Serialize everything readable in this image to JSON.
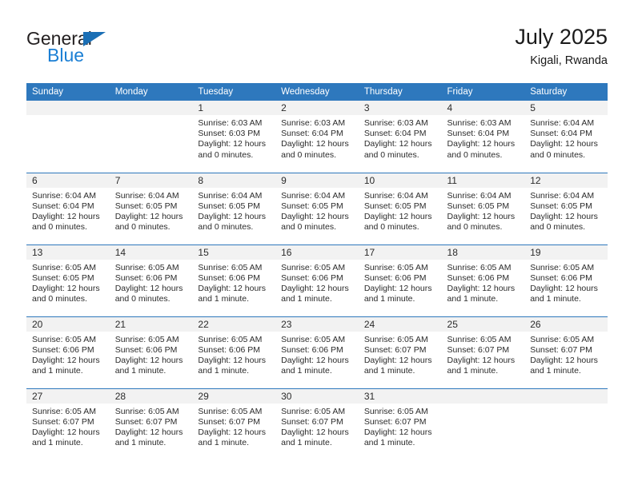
{
  "brand": {
    "name_part1": "General",
    "name_part2": "Blue",
    "triangle_color": "#1b6fb5",
    "blue_text_color": "#1b7fd4"
  },
  "header": {
    "title": "July 2025",
    "subtitle": "Kigali, Rwanda"
  },
  "theme": {
    "header_bar_color": "#2e78bd",
    "daynum_bg": "#f2f2f2",
    "text_color": "#2b2b2b"
  },
  "weekdays": [
    "Sunday",
    "Monday",
    "Tuesday",
    "Wednesday",
    "Thursday",
    "Friday",
    "Saturday"
  ],
  "weeks": [
    [
      {
        "day": "",
        "sunrise": "",
        "sunset": "",
        "daylight1": "",
        "daylight2": "",
        "empty": true
      },
      {
        "day": "",
        "sunrise": "",
        "sunset": "",
        "daylight1": "",
        "daylight2": "",
        "empty": true
      },
      {
        "day": "1",
        "sunrise": "Sunrise: 6:03 AM",
        "sunset": "Sunset: 6:03 PM",
        "daylight1": "Daylight: 12 hours",
        "daylight2": "and 0 minutes."
      },
      {
        "day": "2",
        "sunrise": "Sunrise: 6:03 AM",
        "sunset": "Sunset: 6:04 PM",
        "daylight1": "Daylight: 12 hours",
        "daylight2": "and 0 minutes."
      },
      {
        "day": "3",
        "sunrise": "Sunrise: 6:03 AM",
        "sunset": "Sunset: 6:04 PM",
        "daylight1": "Daylight: 12 hours",
        "daylight2": "and 0 minutes."
      },
      {
        "day": "4",
        "sunrise": "Sunrise: 6:03 AM",
        "sunset": "Sunset: 6:04 PM",
        "daylight1": "Daylight: 12 hours",
        "daylight2": "and 0 minutes."
      },
      {
        "day": "5",
        "sunrise": "Sunrise: 6:04 AM",
        "sunset": "Sunset: 6:04 PM",
        "daylight1": "Daylight: 12 hours",
        "daylight2": "and 0 minutes."
      }
    ],
    [
      {
        "day": "6",
        "sunrise": "Sunrise: 6:04 AM",
        "sunset": "Sunset: 6:04 PM",
        "daylight1": "Daylight: 12 hours",
        "daylight2": "and 0 minutes."
      },
      {
        "day": "7",
        "sunrise": "Sunrise: 6:04 AM",
        "sunset": "Sunset: 6:05 PM",
        "daylight1": "Daylight: 12 hours",
        "daylight2": "and 0 minutes."
      },
      {
        "day": "8",
        "sunrise": "Sunrise: 6:04 AM",
        "sunset": "Sunset: 6:05 PM",
        "daylight1": "Daylight: 12 hours",
        "daylight2": "and 0 minutes."
      },
      {
        "day": "9",
        "sunrise": "Sunrise: 6:04 AM",
        "sunset": "Sunset: 6:05 PM",
        "daylight1": "Daylight: 12 hours",
        "daylight2": "and 0 minutes."
      },
      {
        "day": "10",
        "sunrise": "Sunrise: 6:04 AM",
        "sunset": "Sunset: 6:05 PM",
        "daylight1": "Daylight: 12 hours",
        "daylight2": "and 0 minutes."
      },
      {
        "day": "11",
        "sunrise": "Sunrise: 6:04 AM",
        "sunset": "Sunset: 6:05 PM",
        "daylight1": "Daylight: 12 hours",
        "daylight2": "and 0 minutes."
      },
      {
        "day": "12",
        "sunrise": "Sunrise: 6:04 AM",
        "sunset": "Sunset: 6:05 PM",
        "daylight1": "Daylight: 12 hours",
        "daylight2": "and 0 minutes."
      }
    ],
    [
      {
        "day": "13",
        "sunrise": "Sunrise: 6:05 AM",
        "sunset": "Sunset: 6:05 PM",
        "daylight1": "Daylight: 12 hours",
        "daylight2": "and 0 minutes."
      },
      {
        "day": "14",
        "sunrise": "Sunrise: 6:05 AM",
        "sunset": "Sunset: 6:06 PM",
        "daylight1": "Daylight: 12 hours",
        "daylight2": "and 0 minutes."
      },
      {
        "day": "15",
        "sunrise": "Sunrise: 6:05 AM",
        "sunset": "Sunset: 6:06 PM",
        "daylight1": "Daylight: 12 hours",
        "daylight2": "and 1 minute."
      },
      {
        "day": "16",
        "sunrise": "Sunrise: 6:05 AM",
        "sunset": "Sunset: 6:06 PM",
        "daylight1": "Daylight: 12 hours",
        "daylight2": "and 1 minute."
      },
      {
        "day": "17",
        "sunrise": "Sunrise: 6:05 AM",
        "sunset": "Sunset: 6:06 PM",
        "daylight1": "Daylight: 12 hours",
        "daylight2": "and 1 minute."
      },
      {
        "day": "18",
        "sunrise": "Sunrise: 6:05 AM",
        "sunset": "Sunset: 6:06 PM",
        "daylight1": "Daylight: 12 hours",
        "daylight2": "and 1 minute."
      },
      {
        "day": "19",
        "sunrise": "Sunrise: 6:05 AM",
        "sunset": "Sunset: 6:06 PM",
        "daylight1": "Daylight: 12 hours",
        "daylight2": "and 1 minute."
      }
    ],
    [
      {
        "day": "20",
        "sunrise": "Sunrise: 6:05 AM",
        "sunset": "Sunset: 6:06 PM",
        "daylight1": "Daylight: 12 hours",
        "daylight2": "and 1 minute."
      },
      {
        "day": "21",
        "sunrise": "Sunrise: 6:05 AM",
        "sunset": "Sunset: 6:06 PM",
        "daylight1": "Daylight: 12 hours",
        "daylight2": "and 1 minute."
      },
      {
        "day": "22",
        "sunrise": "Sunrise: 6:05 AM",
        "sunset": "Sunset: 6:06 PM",
        "daylight1": "Daylight: 12 hours",
        "daylight2": "and 1 minute."
      },
      {
        "day": "23",
        "sunrise": "Sunrise: 6:05 AM",
        "sunset": "Sunset: 6:06 PM",
        "daylight1": "Daylight: 12 hours",
        "daylight2": "and 1 minute."
      },
      {
        "day": "24",
        "sunrise": "Sunrise: 6:05 AM",
        "sunset": "Sunset: 6:07 PM",
        "daylight1": "Daylight: 12 hours",
        "daylight2": "and 1 minute."
      },
      {
        "day": "25",
        "sunrise": "Sunrise: 6:05 AM",
        "sunset": "Sunset: 6:07 PM",
        "daylight1": "Daylight: 12 hours",
        "daylight2": "and 1 minute."
      },
      {
        "day": "26",
        "sunrise": "Sunrise: 6:05 AM",
        "sunset": "Sunset: 6:07 PM",
        "daylight1": "Daylight: 12 hours",
        "daylight2": "and 1 minute."
      }
    ],
    [
      {
        "day": "27",
        "sunrise": "Sunrise: 6:05 AM",
        "sunset": "Sunset: 6:07 PM",
        "daylight1": "Daylight: 12 hours",
        "daylight2": "and 1 minute."
      },
      {
        "day": "28",
        "sunrise": "Sunrise: 6:05 AM",
        "sunset": "Sunset: 6:07 PM",
        "daylight1": "Daylight: 12 hours",
        "daylight2": "and 1 minute."
      },
      {
        "day": "29",
        "sunrise": "Sunrise: 6:05 AM",
        "sunset": "Sunset: 6:07 PM",
        "daylight1": "Daylight: 12 hours",
        "daylight2": "and 1 minute."
      },
      {
        "day": "30",
        "sunrise": "Sunrise: 6:05 AM",
        "sunset": "Sunset: 6:07 PM",
        "daylight1": "Daylight: 12 hours",
        "daylight2": "and 1 minute."
      },
      {
        "day": "31",
        "sunrise": "Sunrise: 6:05 AM",
        "sunset": "Sunset: 6:07 PM",
        "daylight1": "Daylight: 12 hours",
        "daylight2": "and 1 minute."
      },
      {
        "day": "",
        "sunrise": "",
        "sunset": "",
        "daylight1": "",
        "daylight2": "",
        "empty": true
      },
      {
        "day": "",
        "sunrise": "",
        "sunset": "",
        "daylight1": "",
        "daylight2": "",
        "empty": true
      }
    ]
  ]
}
